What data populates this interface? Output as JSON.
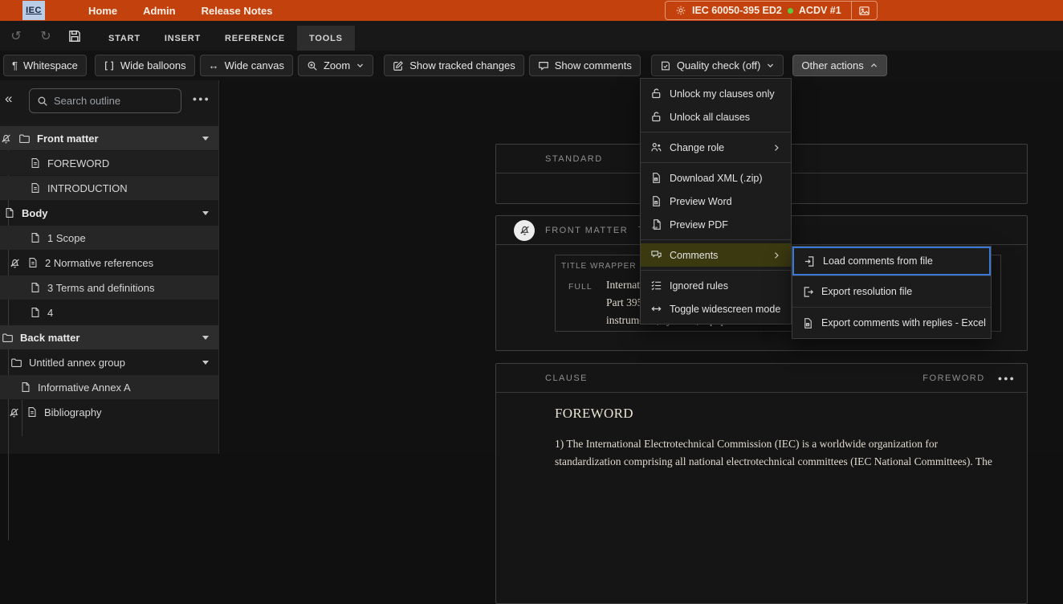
{
  "topbar": {
    "logo_text": "IEC",
    "nav": [
      {
        "label": "Home"
      },
      {
        "label": "Admin"
      },
      {
        "label": "Release Notes"
      }
    ],
    "project": {
      "code": "IEC 60050-395 ED2",
      "stage": "ACDV #1"
    }
  },
  "ribbon": {
    "tabs": [
      {
        "label": "START"
      },
      {
        "label": "INSERT"
      },
      {
        "label": "REFERENCE"
      },
      {
        "label": "TOOLS",
        "active": true
      }
    ]
  },
  "toolbar": {
    "whitespace": "Whitespace",
    "wide_balloons": "Wide balloons",
    "wide_canvas": "Wide canvas",
    "zoom": "Zoom",
    "show_tracked_changes": "Show tracked changes",
    "show_comments": "Show comments",
    "quality_check": "Quality check (off)",
    "other_actions": "Other actions"
  },
  "sidebar": {
    "search_placeholder": "Search outline",
    "tree": [
      {
        "label": "Front matter"
      },
      {
        "label": "FOREWORD"
      },
      {
        "label": "INTRODUCTION"
      },
      {
        "label": "Body"
      },
      {
        "label": "1 Scope"
      },
      {
        "label": "2 Normative references"
      },
      {
        "label": "3 Terms and definitions"
      },
      {
        "label": "4"
      },
      {
        "label": "Back matter"
      },
      {
        "label": "Untitled annex group"
      },
      {
        "label": "Informative Annex A"
      },
      {
        "label": "Bibliography"
      }
    ]
  },
  "menu": {
    "items": [
      {
        "label": "Unlock my clauses only"
      },
      {
        "label": "Unlock all clauses"
      },
      {
        "label": "Change role"
      },
      {
        "label": "Download XML (.zip)"
      },
      {
        "label": "Preview Word"
      },
      {
        "label": "Preview PDF"
      },
      {
        "label": "Comments",
        "highlighted": true
      },
      {
        "label": "Ignored rules"
      },
      {
        "label": "Toggle widescreen mode"
      }
    ]
  },
  "submenu": {
    "items": [
      {
        "label": "Load comments from file",
        "focused": true
      },
      {
        "label": "Export resolution file"
      },
      {
        "label": "Export comments with replies - Excel"
      }
    ]
  },
  "document": {
    "standard": {
      "type_label": "STANDARD"
    },
    "front_matter": {
      "type_label": "FRONT MATTER",
      "note": "Titles cannot be edited directly",
      "wrapper_label": "TITLE WRAPPER",
      "full_label": "FULL",
      "title_lines": [
        "International Electrotechnical Vocabulary (IEV) –",
        "Part 395: Nuclear instrumentation – Physical phenomena, basic concepts,",
        "instruments, systems, equipment and detectors"
      ]
    },
    "clause": {
      "type_label": "CLAUSE",
      "name": "FOREWORD",
      "heading": "FOREWORD",
      "paragraph_lines": [
        "1) The International Electrotechnical Commission (IEC) is a worldwide organization for",
        "standardization comprising all national electrotechnical committees (IEC National Committees). The"
      ]
    }
  },
  "colors": {
    "accent_orange": "#c2410c",
    "status_green": "#5ec93e",
    "focus_blue": "#3b77d4",
    "menu_highlight": "#3a3910"
  }
}
